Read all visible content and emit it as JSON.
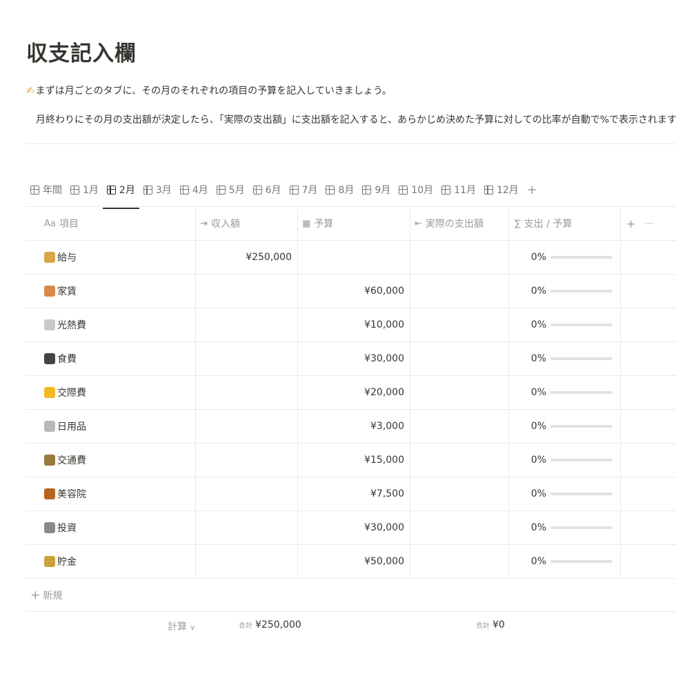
{
  "page": {
    "title": "収支記入欄",
    "intro_emoji": "✍",
    "intro_line1": "まずは月ごとのタブに、その月のそれぞれの項目の予算を記入していきましょう。",
    "intro_line2": "月終わりにその月の支出額が決定したら、「実際の支出額」に支出額を記入すると、あらかじめ決めた予算に対しての比率が自動で%で表示されます。"
  },
  "tabs": [
    {
      "label": "年間",
      "active": false
    },
    {
      "label": "1月",
      "active": false
    },
    {
      "label": "2月",
      "active": true
    },
    {
      "label": "3月",
      "active": false
    },
    {
      "label": "4月",
      "active": false
    },
    {
      "label": "5月",
      "active": false
    },
    {
      "label": "6月",
      "active": false
    },
    {
      "label": "7月",
      "active": false
    },
    {
      "label": "8月",
      "active": false
    },
    {
      "label": "9月",
      "active": false
    },
    {
      "label": "10月",
      "active": false
    },
    {
      "label": "11月",
      "active": false
    },
    {
      "label": "12月",
      "active": false
    }
  ],
  "tab_add": "+",
  "columns": {
    "name": {
      "icon": "Aa",
      "label": "項目"
    },
    "income": {
      "icon": "⇥",
      "label": "収入額"
    },
    "budget": {
      "icon": "▦",
      "label": "予算"
    },
    "actual": {
      "icon": "⇤",
      "label": "実際の支出額"
    },
    "ratio": {
      "icon": "∑",
      "label": "支出 / 予算"
    },
    "add": "+",
    "more": "···"
  },
  "rows": [
    {
      "emoji_color": "#d9a74a",
      "name": "給与",
      "income": "¥250,000",
      "budget": "",
      "actual": "",
      "ratio": "0%",
      "ratio_value": 0
    },
    {
      "emoji_color": "#d98a4a",
      "name": "家賃",
      "income": "",
      "budget": "¥60,000",
      "actual": "",
      "ratio": "0%",
      "ratio_value": 0
    },
    {
      "emoji_color": "#c9c9c9",
      "name": "光熱費",
      "income": "",
      "budget": "¥10,000",
      "actual": "",
      "ratio": "0%",
      "ratio_value": 0
    },
    {
      "emoji_color": "#444444",
      "name": "食費",
      "income": "",
      "budget": "¥30,000",
      "actual": "",
      "ratio": "0%",
      "ratio_value": 0
    },
    {
      "emoji_color": "#f2b920",
      "name": "交際費",
      "income": "",
      "budget": "¥20,000",
      "actual": "",
      "ratio": "0%",
      "ratio_value": 0
    },
    {
      "emoji_color": "#b8b8b8",
      "name": "日用品",
      "income": "",
      "budget": "¥3,000",
      "actual": "",
      "ratio": "0%",
      "ratio_value": 0
    },
    {
      "emoji_color": "#9a7a3a",
      "name": "交通費",
      "income": "",
      "budget": "¥15,000",
      "actual": "",
      "ratio": "0%",
      "ratio_value": 0
    },
    {
      "emoji_color": "#b5651d",
      "name": "美容院",
      "income": "",
      "budget": "¥7,500",
      "actual": "",
      "ratio": "0%",
      "ratio_value": 0
    },
    {
      "emoji_color": "#8a8a8a",
      "name": "投資",
      "income": "",
      "budget": "¥30,000",
      "actual": "",
      "ratio": "0%",
      "ratio_value": 0
    },
    {
      "emoji_color": "#c9a23a",
      "name": "貯金",
      "income": "",
      "budget": "¥50,000",
      "actual": "",
      "ratio": "0%",
      "ratio_value": 0
    }
  ],
  "new_row": {
    "plus": "+",
    "label": "新規"
  },
  "footer": {
    "calc_label": "計算",
    "calc_chevron": "∨",
    "sum_label": "合計",
    "income_sum": "¥250,000",
    "actual_sum": "¥0"
  },
  "colors": {
    "accent": "#2eaadc",
    "text": "#37352f",
    "muted": "#9b9a97",
    "border": "#e9e9e7"
  }
}
